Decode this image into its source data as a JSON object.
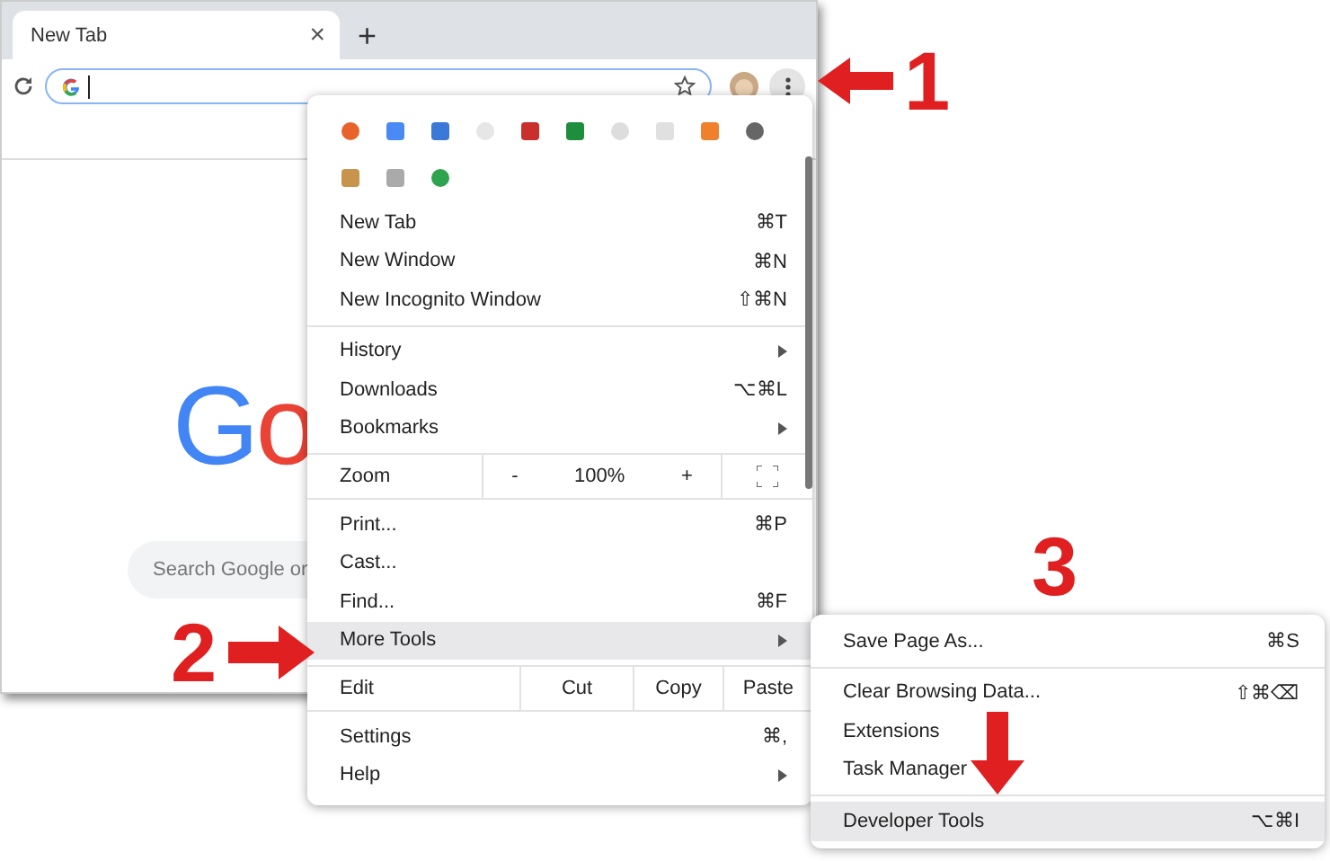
{
  "tab": {
    "title": "New Tab",
    "close": "×",
    "new_tab": "+"
  },
  "page": {
    "logo_text": "Go",
    "search_placeholder": "Search Google or"
  },
  "menu": {
    "sections": [
      [
        {
          "kind": "item",
          "label": "New Tab",
          "shortcut": "⌘T",
          "submenu": false,
          "selected": false
        },
        {
          "kind": "item",
          "label": "New Window",
          "shortcut": "⌘N",
          "submenu": false,
          "selected": false
        },
        {
          "kind": "item",
          "label": "New Incognito Window",
          "shortcut": "⇧⌘N",
          "submenu": false,
          "selected": false
        }
      ],
      [
        {
          "kind": "item",
          "label": "History",
          "submenu": true,
          "selected": false
        },
        {
          "kind": "item",
          "label": "Downloads",
          "shortcut": "⌥⌘L",
          "submenu": false,
          "selected": false
        },
        {
          "kind": "item",
          "label": "Bookmarks",
          "submenu": true,
          "selected": false
        }
      ],
      [
        {
          "kind": "zoom",
          "label": "Zoom",
          "minus": "-",
          "value": "100%",
          "plus": "+"
        }
      ],
      [
        {
          "kind": "item",
          "label": "Print...",
          "shortcut": "⌘P",
          "submenu": false,
          "selected": false
        },
        {
          "kind": "item",
          "label": "Cast...",
          "submenu": false,
          "selected": false
        },
        {
          "kind": "item",
          "label": "Find...",
          "shortcut": "⌘F",
          "submenu": false,
          "selected": false
        },
        {
          "kind": "item",
          "label": "More Tools",
          "submenu": true,
          "selected": true
        }
      ],
      [
        {
          "kind": "edit",
          "label": "Edit",
          "buttons": [
            "Cut",
            "Copy",
            "Paste"
          ]
        }
      ],
      [
        {
          "kind": "item",
          "label": "Settings",
          "shortcut": "⌘,",
          "submenu": false,
          "selected": false
        },
        {
          "kind": "item",
          "label": "Help",
          "submenu": true,
          "selected": false
        }
      ]
    ]
  },
  "submenu": {
    "sections": [
      [
        {
          "kind": "item",
          "label": "Save Page As...",
          "shortcut": "⌘S",
          "submenu": false,
          "selected": false
        }
      ],
      [
        {
          "kind": "item",
          "label": "Clear Browsing Data...",
          "shortcut": "⇧⌘⌫",
          "submenu": false,
          "selected": false
        },
        {
          "kind": "item",
          "label": "Extensions",
          "submenu": false,
          "selected": false
        },
        {
          "kind": "item",
          "label": "Task Manager",
          "submenu": false,
          "selected": false
        }
      ],
      [
        {
          "kind": "item",
          "label": "Developer Tools",
          "shortcut": "⌥⌘I",
          "submenu": false,
          "selected": true
        }
      ]
    ]
  },
  "annotations": [
    {
      "number": "1",
      "kind": "left"
    },
    {
      "number": "2",
      "kind": "right"
    },
    {
      "number": "3",
      "kind": "down"
    }
  ]
}
